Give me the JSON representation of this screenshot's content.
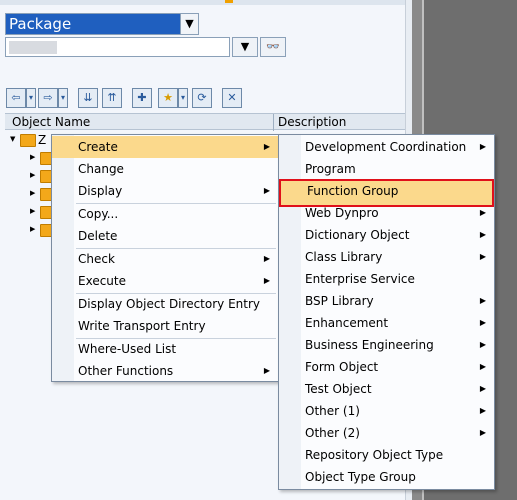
{
  "package_selector": {
    "value": "Package",
    "dropdown_icon": "chevron-down-icon"
  },
  "toolbar": {
    "icons": [
      "back-icon",
      "forward-icon",
      "expand-icon",
      "collapse-icon",
      "hierarchy-icon",
      "favorites-icon",
      "refresh-icon",
      "close-icon"
    ]
  },
  "tree": {
    "columns": [
      "Object Name",
      "Description"
    ],
    "root_label": "Z"
  },
  "context_menu": {
    "items": [
      {
        "label": "Create",
        "submenu": true
      },
      {
        "label": "Change",
        "submenu": false
      },
      {
        "label": "Display",
        "submenu": true
      },
      {
        "label": "Copy...",
        "submenu": false
      },
      {
        "label": "Delete",
        "submenu": false
      },
      {
        "label": "Check",
        "submenu": true
      },
      {
        "label": "Execute",
        "submenu": true
      },
      {
        "label": "Display Object Directory Entry",
        "submenu": false
      },
      {
        "label": "Write Transport Entry",
        "submenu": false
      },
      {
        "label": "Where-Used List",
        "submenu": false
      },
      {
        "label": "Other Functions",
        "submenu": true
      }
    ]
  },
  "create_submenu": {
    "items": [
      {
        "label": "Development Coordination",
        "submenu": true
      },
      {
        "label": "Program",
        "submenu": false
      },
      {
        "label": "Function Group",
        "submenu": false
      },
      {
        "label": "Web Dynpro",
        "submenu": true
      },
      {
        "label": "Dictionary Object",
        "submenu": true
      },
      {
        "label": "Class Library",
        "submenu": true
      },
      {
        "label": "Enterprise Service",
        "submenu": false
      },
      {
        "label": "BSP Library",
        "submenu": true
      },
      {
        "label": "Enhancement",
        "submenu": true
      },
      {
        "label": "Business Engineering",
        "submenu": true
      },
      {
        "label": "Form Object",
        "submenu": true
      },
      {
        "label": "Test Object",
        "submenu": true
      },
      {
        "label": "Other (1)",
        "submenu": true
      },
      {
        "label": "Other (2)",
        "submenu": true
      },
      {
        "label": "Repository Object Type",
        "submenu": false
      },
      {
        "label": "Object Type Group",
        "submenu": false
      }
    ],
    "highlighted": "Function Group"
  },
  "colors": {
    "selection_blue": "#1f5fbf",
    "menu_hover": "#fbd98c",
    "highlight_red": "#e0101a"
  }
}
